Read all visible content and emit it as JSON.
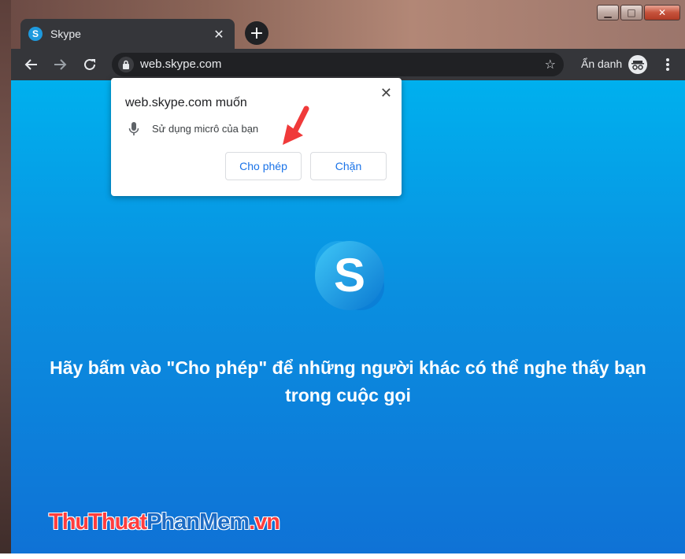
{
  "browser": {
    "tab_title": "Skype",
    "tab_close": "✕",
    "new_tab": "+",
    "url": "web.skype.com",
    "incognito_label": "Ẩn danh",
    "window_controls": {
      "minimize": "▁",
      "maximize": "□",
      "close": "✕"
    }
  },
  "permission_popup": {
    "title": "web.skype.com muốn",
    "item": "Sử dụng micrô của bạn",
    "allow_label": "Cho phép",
    "block_label": "Chặn",
    "close": "✕"
  },
  "page": {
    "message": "Hãy bấm vào \"Cho phép\" để những người khác có thể nghe thấy bạn trong cuộc gọi",
    "logo_letter": "S"
  },
  "watermark": {
    "part1": "ThuThuat",
    "part2": "PhanMem",
    "part3": ".vn"
  },
  "colors": {
    "skype_blue": "#00aff0",
    "chrome_dark": "#35363a",
    "annotation_red": "#f03a3a",
    "button_blue": "#1a73e8"
  },
  "icons": [
    "back-arrow-icon",
    "forward-arrow-icon",
    "reload-icon",
    "lock-icon",
    "star-icon",
    "incognito-icon",
    "menu-icon",
    "mic-icon",
    "skype-logo-icon"
  ]
}
